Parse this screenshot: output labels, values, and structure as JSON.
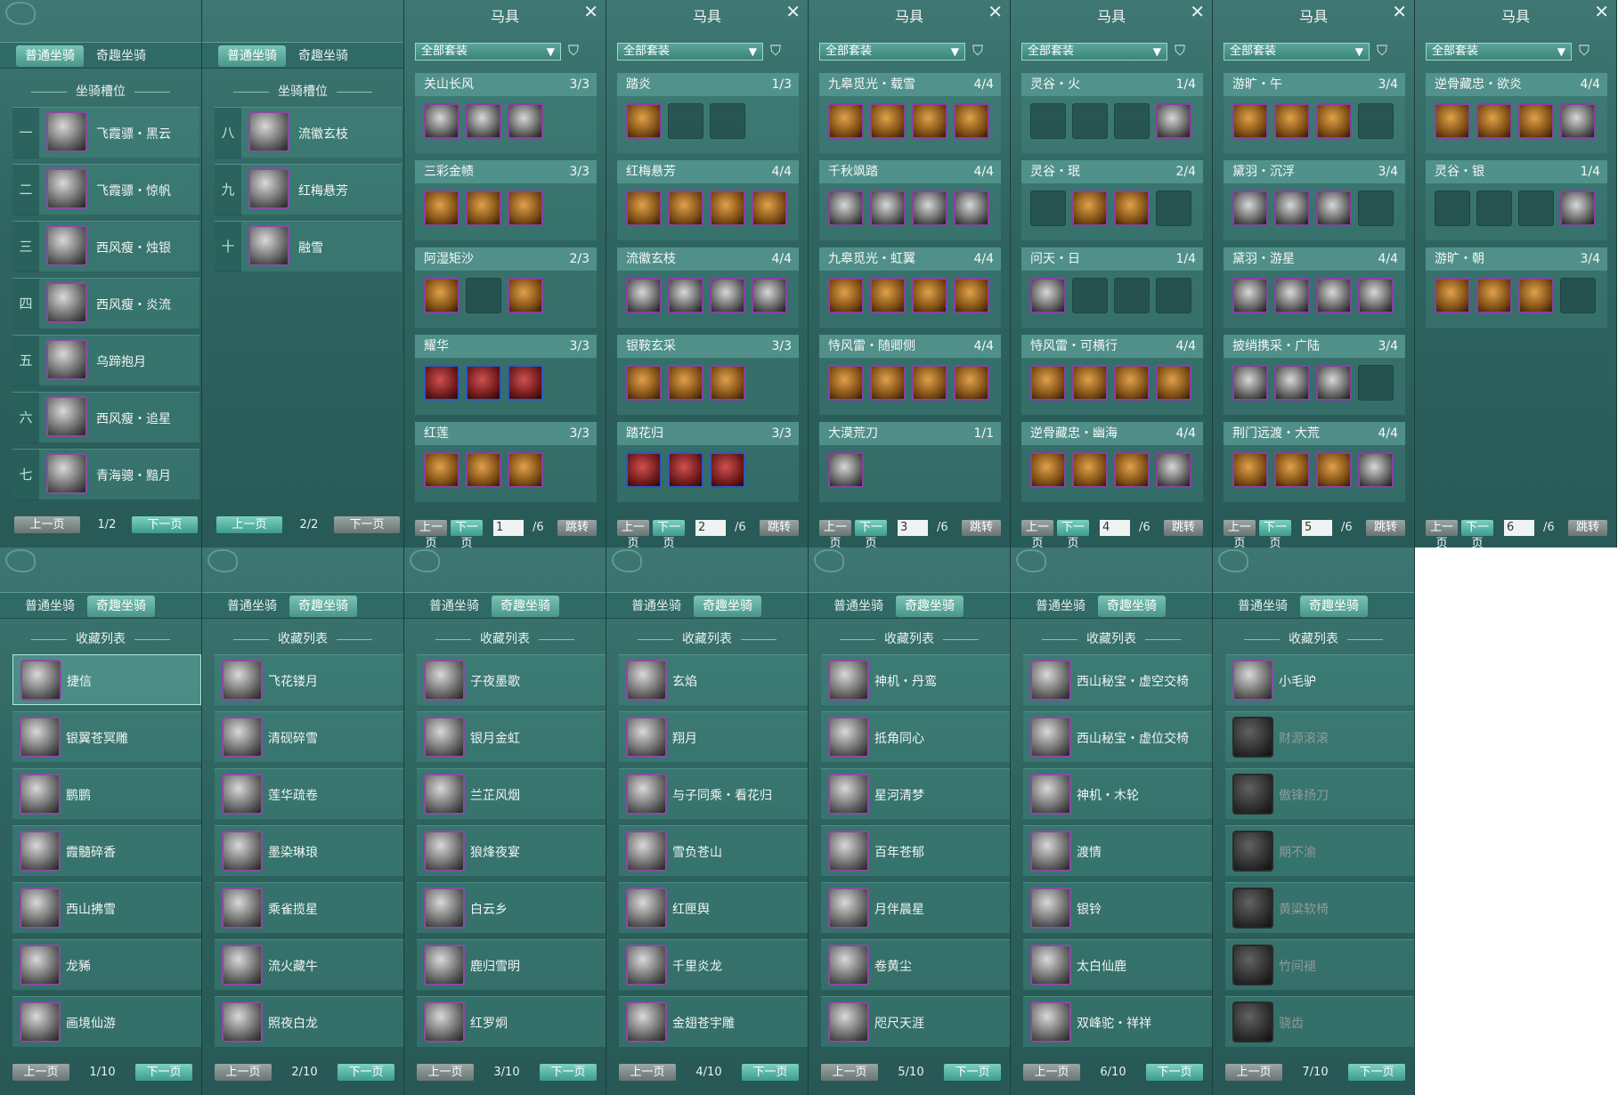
{
  "top_left": {
    "tabs": [
      "普通坐骑",
      "奇趣坐骑"
    ],
    "section": "坐骑槽位",
    "page1": {
      "slots": [
        {
          "num": "一",
          "name": "飞霞骠・黑云"
        },
        {
          "num": "二",
          "name": "飞霞骠・惊帆"
        },
        {
          "num": "三",
          "name": "西风瘦・烛银"
        },
        {
          "num": "四",
          "name": "西风瘦・炎流"
        },
        {
          "num": "五",
          "name": "乌蹄抱月"
        },
        {
          "num": "六",
          "name": "西风瘦・追星"
        },
        {
          "num": "七",
          "name": "青海骢・黯月"
        }
      ],
      "prev": "上一页",
      "next": "下一页",
      "page": "1/2"
    },
    "page2": {
      "slots": [
        {
          "num": "八",
          "name": "流徽玄枝"
        },
        {
          "num": "九",
          "name": "红梅悬芳"
        },
        {
          "num": "十",
          "name": "融雪"
        }
      ],
      "prev": "上一页",
      "next": "下一页",
      "page": "2/2"
    }
  },
  "gear": {
    "title": "马具",
    "filter": "全部套装",
    "prev": "上一页",
    "next": "下一页",
    "jump": "跳转",
    "total": "/6",
    "pages": [
      {
        "page": "1",
        "sets": [
          {
            "name": "关山长风",
            "count": "3/3",
            "items": [
              "w",
              "w",
              "w"
            ]
          },
          {
            "name": "三彩金帻",
            "count": "3/3",
            "items": [
              "f",
              "f",
              "f"
            ]
          },
          {
            "name": "阿湿矩沙",
            "count": "2/3",
            "items": [
              "f",
              "e",
              "f"
            ]
          },
          {
            "name": "耀华",
            "count": "3/3",
            "items": [
              "s",
              "s",
              "s"
            ]
          },
          {
            "name": "红莲",
            "count": "3/3",
            "items": [
              "f",
              "f",
              "f"
            ]
          }
        ]
      },
      {
        "page": "2",
        "sets": [
          {
            "name": "踏炎",
            "count": "1/3",
            "items": [
              "f",
              "e",
              "e"
            ]
          },
          {
            "name": "红梅悬芳",
            "count": "4/4",
            "items": [
              "f",
              "f",
              "f",
              "f"
            ]
          },
          {
            "name": "流徽玄枝",
            "count": "4/4",
            "items": [
              "w",
              "w",
              "w",
              "w"
            ]
          },
          {
            "name": "银鞍玄采",
            "count": "3/3",
            "items": [
              "f",
              "f",
              "f"
            ]
          },
          {
            "name": "踏花归",
            "count": "3/3",
            "items": [
              "s",
              "s",
              "s"
            ]
          }
        ]
      },
      {
        "page": "3",
        "sets": [
          {
            "name": "九皋觅光・载雪",
            "count": "4/4",
            "items": [
              "f",
              "f",
              "f",
              "f"
            ]
          },
          {
            "name": "千秋飒踏",
            "count": "4/4",
            "items": [
              "w",
              "w",
              "w",
              "w"
            ]
          },
          {
            "name": "九皋觅光・虹翼",
            "count": "4/4",
            "items": [
              "f",
              "f",
              "f",
              "f"
            ]
          },
          {
            "name": "恃风雷・随卿侧",
            "count": "4/4",
            "items": [
              "f",
              "f",
              "f",
              "f"
            ]
          },
          {
            "name": "大漠荒刀",
            "count": "1/1",
            "items": [
              "w"
            ]
          }
        ]
      },
      {
        "page": "4",
        "sets": [
          {
            "name": "灵谷・火",
            "count": "1/4",
            "items": [
              "e",
              "e",
              "e",
              "w"
            ]
          },
          {
            "name": "灵谷・珉",
            "count": "2/4",
            "items": [
              "e",
              "f",
              "f",
              "e"
            ]
          },
          {
            "name": "问天・日",
            "count": "1/4",
            "items": [
              "w",
              "e",
              "e",
              "e"
            ]
          },
          {
            "name": "恃风雷・可横行",
            "count": "4/4",
            "items": [
              "f",
              "f",
              "f",
              "f"
            ]
          },
          {
            "name": "逆骨藏忠・幽海",
            "count": "4/4",
            "items": [
              "f",
              "f",
              "f",
              "w"
            ]
          }
        ]
      },
      {
        "page": "5",
        "sets": [
          {
            "name": "游旷・午",
            "count": "3/4",
            "items": [
              "f",
              "f",
              "f",
              "e"
            ]
          },
          {
            "name": "黛羽・沉浮",
            "count": "3/4",
            "items": [
              "w",
              "w",
              "w",
              "e"
            ]
          },
          {
            "name": "黛羽・游星",
            "count": "4/4",
            "items": [
              "w",
              "w",
              "w",
              "w"
            ]
          },
          {
            "name": "披绡携采・广陆",
            "count": "3/4",
            "items": [
              "w",
              "w",
              "w",
              "e"
            ]
          },
          {
            "name": "荆门远渡・大荒",
            "count": "4/4",
            "items": [
              "f",
              "f",
              "f",
              "w"
            ]
          }
        ]
      },
      {
        "page": "6",
        "sets": [
          {
            "name": "逆骨藏忠・欲炎",
            "count": "4/4",
            "items": [
              "f",
              "f",
              "f",
              "w"
            ]
          },
          {
            "name": "灵谷・银",
            "count": "1/4",
            "items": [
              "e",
              "e",
              "e",
              "w"
            ]
          },
          {
            "name": "游旷・朝",
            "count": "3/4",
            "items": [
              "f",
              "f",
              "f",
              "e"
            ]
          }
        ]
      }
    ]
  },
  "collection": {
    "tabs": [
      "普通坐骑",
      "奇趣坐骑"
    ],
    "section": "收藏列表",
    "prev": "上一页",
    "next": "下一页",
    "pages": [
      {
        "page": "1/10",
        "names": [
          "捷信",
          "银翼苍冥雕",
          "鹏鹏",
          "霞髓碎香",
          "西山拂雪",
          "龙豨",
          "画境仙游"
        ]
      },
      {
        "page": "2/10",
        "names": [
          "飞花镂月",
          "清砚碎雪",
          "莲华疏卷",
          "墨染琳琅",
          "乘雀揽星",
          "流火藏牛",
          "照夜白龙"
        ]
      },
      {
        "page": "3/10",
        "names": [
          "子夜墨歌",
          "银月金虹",
          "兰芷风烟",
          "狼烽夜宴",
          "白云乡",
          "鹿归雪明",
          "红罗炯"
        ]
      },
      {
        "page": "4/10",
        "names": [
          "玄焰",
          "翔月",
          "与子同乘・看花归",
          "雪负苍山",
          "红匣舆",
          "千里炎龙",
          "金翅苍宇雕"
        ]
      },
      {
        "page": "5/10",
        "names": [
          "神机・丹鸾",
          "抵角同心",
          "星河清梦",
          "百年苍郁",
          "月伴晨星",
          "卷黄尘",
          "咫尺天涯"
        ]
      },
      {
        "page": "6/10",
        "names": [
          "西山秘宝・虚空交椅",
          "西山秘宝・虚位交椅",
          "神机・木轮",
          "渡情",
          "银铃",
          "太白仙鹿",
          "双峰驼・祥祥"
        ]
      },
      {
        "page": "7/10",
        "names": [
          "小毛驴",
          "财源滚滚",
          "傲锋扬刀",
          "期不渝",
          "黄粱软椅",
          "竹间褪",
          "骁齿"
        ]
      }
    ]
  },
  "colors": {
    "panel": "#2f6561",
    "accent": "#7cd0bf",
    "frame_purple": "#8a3fa5",
    "frame_blue": "#2e58b8"
  }
}
